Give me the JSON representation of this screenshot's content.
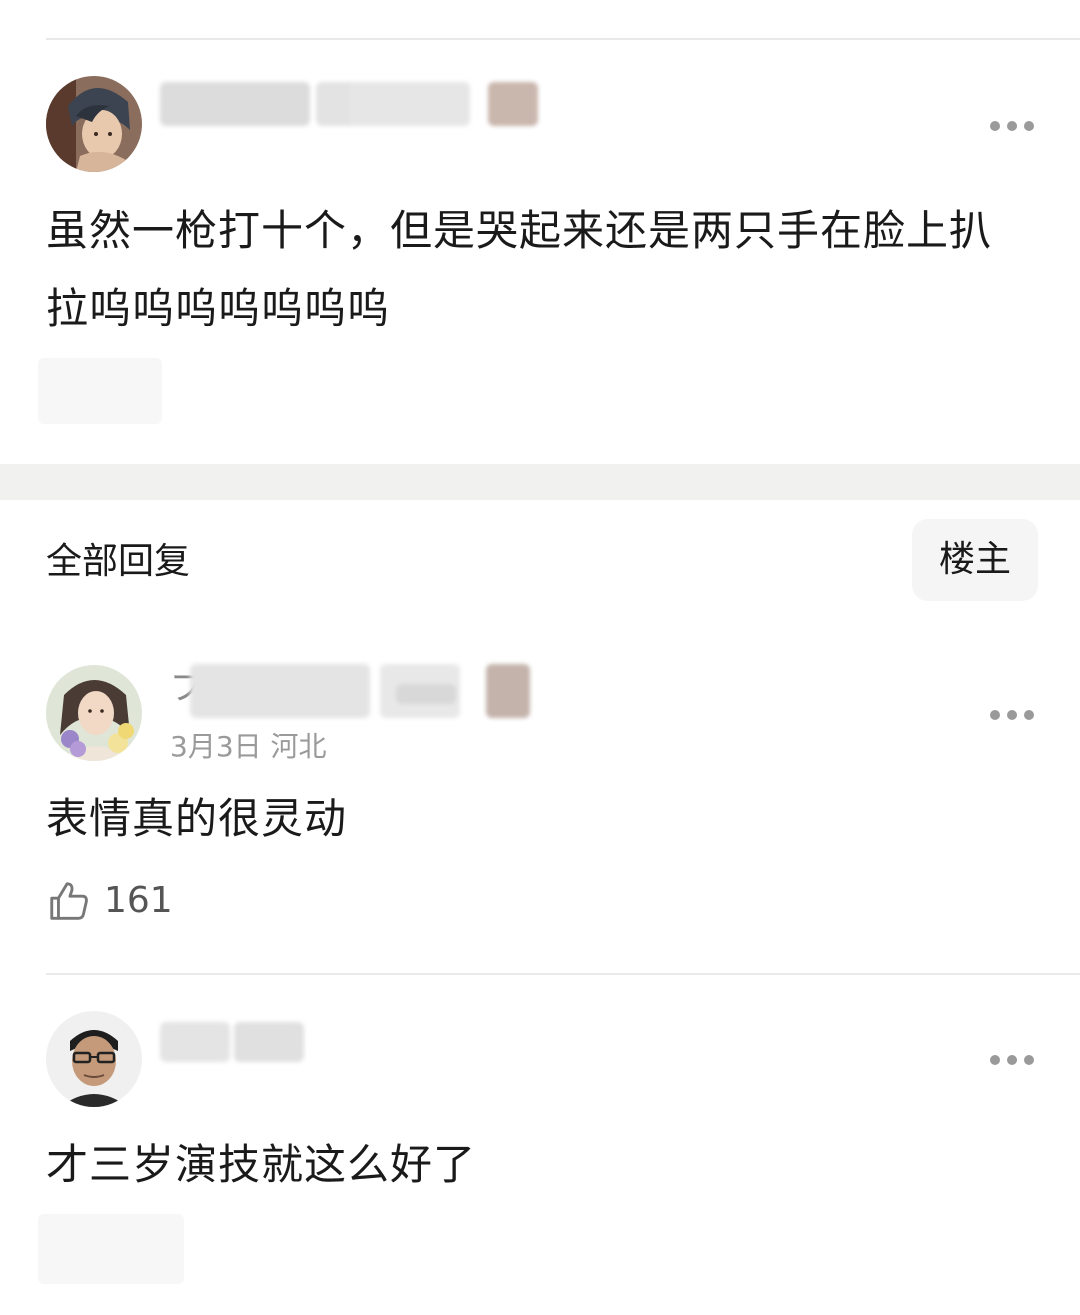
{
  "main_post": {
    "avatar_icon": "user-avatar-icon",
    "text": "虽然一枪打十个，但是哭起来还是两只手在脸上扒拉呜呜呜呜呜呜呜"
  },
  "replies_header": {
    "title": "全部回复",
    "filter_label": "楼主"
  },
  "replies": [
    {
      "avatar_icon": "user-avatar-icon",
      "name_prefix": "ブ",
      "meta": "3月3日 河北",
      "text": "表情真的很灵动",
      "like_icon": "thumbs-up-icon",
      "likes": "161"
    },
    {
      "avatar_icon": "user-avatar-icon",
      "text": "才三岁演技就这么好了"
    }
  ],
  "icons": {
    "more": "more-dots-icon"
  },
  "colors": {
    "text": "#1a1a1a",
    "muted": "#9a9a9a",
    "divider": "#ebebeb",
    "section_gap": "#f1f1f0"
  }
}
